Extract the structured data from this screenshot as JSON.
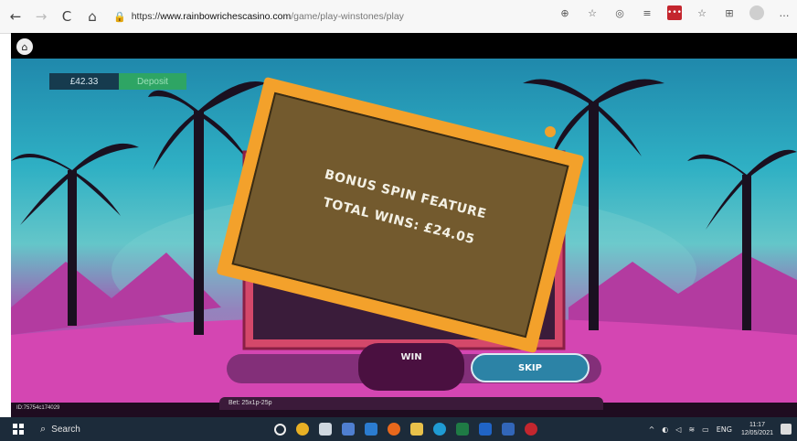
{
  "browser": {
    "back_icon": "←",
    "forward_icon": "→",
    "reload_icon": "C",
    "home_icon": "⌂",
    "lock_icon": "🔒",
    "url_prefix": "https://",
    "url_domain": "www.rainbowrichescasino.com",
    "url_path": "/game/play-winstones/play",
    "toolbar_icons": [
      "zoom-icon",
      "favorite-icon",
      "shield-icon",
      "extensions-icon",
      "lastpass-icon",
      "collections-icon",
      "favorites-bar-icon",
      "profile-icon",
      "more-icon"
    ]
  },
  "game": {
    "balance": "£42.33",
    "deposit_label": "Deposit",
    "bonus_title": "BONUS SPIN FEATURE",
    "bonus_total": "TOTAL WINS: £24.05",
    "win_label": "WIN",
    "skip_label": "SKIP",
    "game_id": "ID:75754c174029",
    "bet": "Bet: 25x1p-25p",
    "colors": {
      "card_frame": "#f3a12b",
      "card_inner": "#735a2e",
      "deposit": "#2ea564",
      "skip": "#2c83a6"
    }
  },
  "taskbar": {
    "search_label": "Search",
    "apps": [
      "cortana",
      "chrome",
      "people",
      "security",
      "mail",
      "firefox",
      "file-explorer",
      "edge",
      "excel",
      "outlook",
      "word",
      "teams"
    ],
    "tray_lang": "ENG",
    "time": "11:17",
    "date": "12/05/2021"
  }
}
